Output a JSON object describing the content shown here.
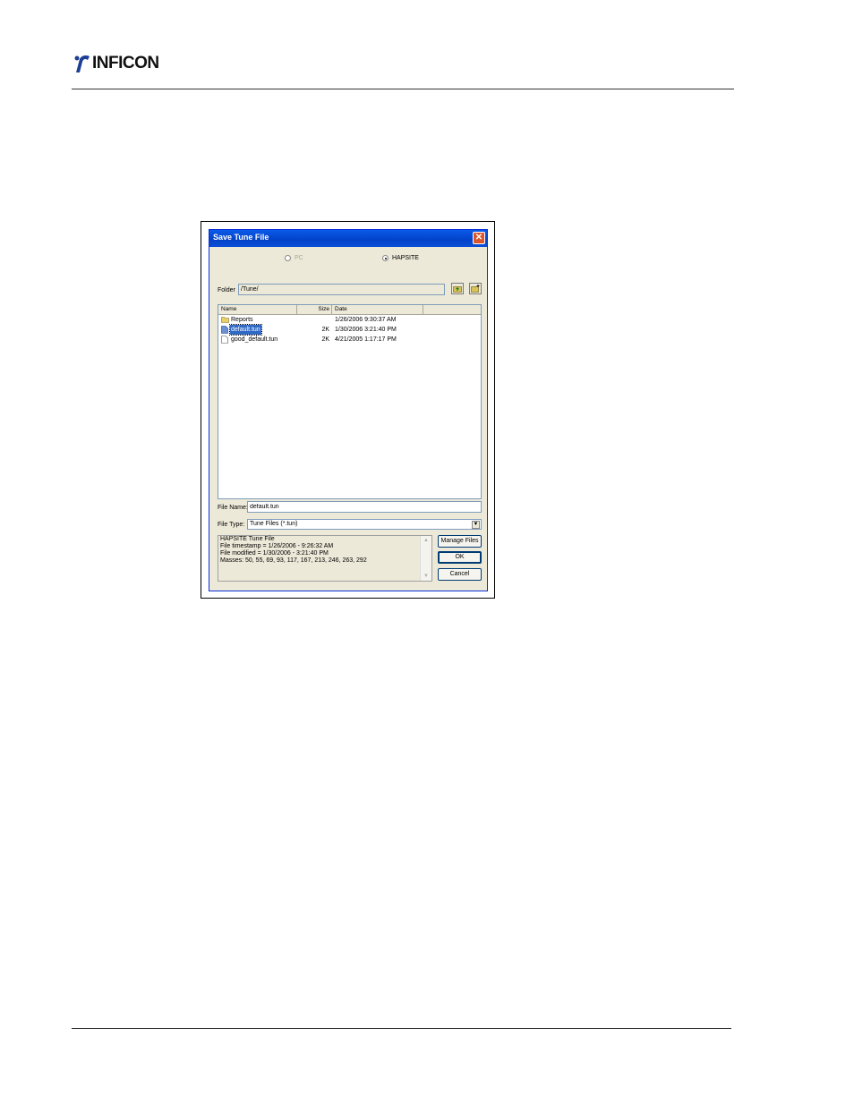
{
  "header": {
    "logo_text": "INFICON"
  },
  "dialog": {
    "title": "Save Tune File",
    "source_options": [
      {
        "label": "PC",
        "selected": false,
        "disabled": true
      },
      {
        "label": "HAPSITE",
        "selected": true,
        "disabled": false
      }
    ],
    "folder_label": "Folder",
    "folder_value": "/Tune/",
    "columns": [
      "Name",
      "Size",
      "Date"
    ],
    "files": [
      {
        "name": "Reports",
        "size": "",
        "date": "1/26/2006 9:30:37 AM",
        "type": "folder",
        "selected": false
      },
      {
        "name": "default.tun",
        "size": "2K",
        "date": "1/30/2006 3:21:40 PM",
        "type": "file",
        "selected": true
      },
      {
        "name": "good_default.tun",
        "size": "2K",
        "date": "4/21/2005 1:17:17 PM",
        "type": "file",
        "selected": false
      }
    ],
    "file_name_label": "File Name:",
    "file_name_value": "default.tun",
    "file_type_label": "File Type:",
    "file_type_value": "Tune Files (*.tun)",
    "info_lines": [
      "HAPSITE Tune File",
      "File timestamp = 1/26/2006 - 9:26:32 AM",
      "File modified = 1/30/2006 - 3:21:40 PM",
      "Masses: 50, 55, 69, 93, 117, 167, 213, 246, 263, 292"
    ],
    "buttons": {
      "manage": "Manage Files",
      "ok": "OK",
      "cancel": "Cancel"
    }
  }
}
